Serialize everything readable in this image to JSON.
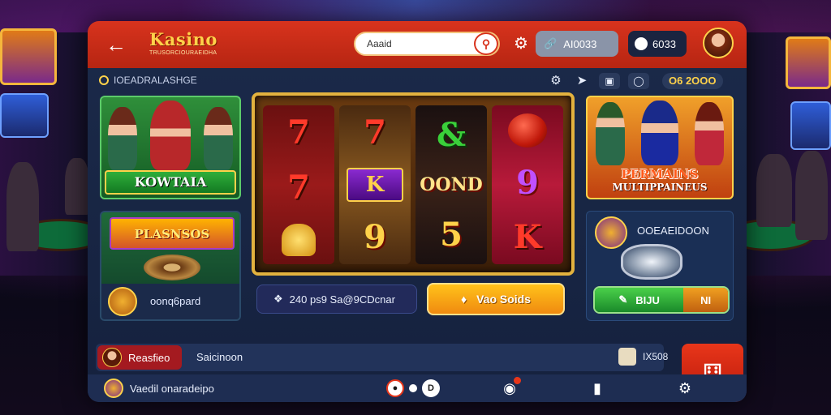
{
  "header": {
    "back_icon": "arrow-left-icon",
    "logo_name": "Kasino",
    "logo_tagline": "TRUSORCIOURAEIDHA",
    "search_placeholder": "Aaaid",
    "coins_label": "AI0033",
    "balance_label": "6033"
  },
  "subbar": {
    "title": "IOEADRALASHGE",
    "balance": "O6 2OOO"
  },
  "cards": {
    "featured_left": {
      "label": "KOWTAIA"
    },
    "promo_left": {
      "title": "PLASNSOS",
      "footer": "oonq6pard"
    },
    "featured_right": {
      "title": "PERMAINS",
      "subtitle": "MULTIPPAINEUS"
    },
    "side_right": {
      "title": "OOEAEIDOON",
      "go_label": "BIJU",
      "go_alt_label": "NI"
    }
  },
  "slot": {
    "reels": [
      [
        "7",
        "7",
        "coin"
      ],
      [
        "7",
        "K",
        "9"
      ],
      [
        "&",
        "OOND",
        "5"
      ],
      [
        "cherry",
        "9",
        "K"
      ]
    ],
    "stat_text": "240 ps9 Sa@9CDcnar",
    "bet_label": "Vao Soids"
  },
  "chat": {
    "user": "Reasfieo",
    "message": "Saicinoon",
    "count": "IX508"
  },
  "footer": {
    "user_text": "Vaedil onaradeipo",
    "dot_label": "D"
  },
  "colors": {
    "accent": "#d8331d",
    "gold": "#ffd24a",
    "panel": "#1b2a4a"
  }
}
